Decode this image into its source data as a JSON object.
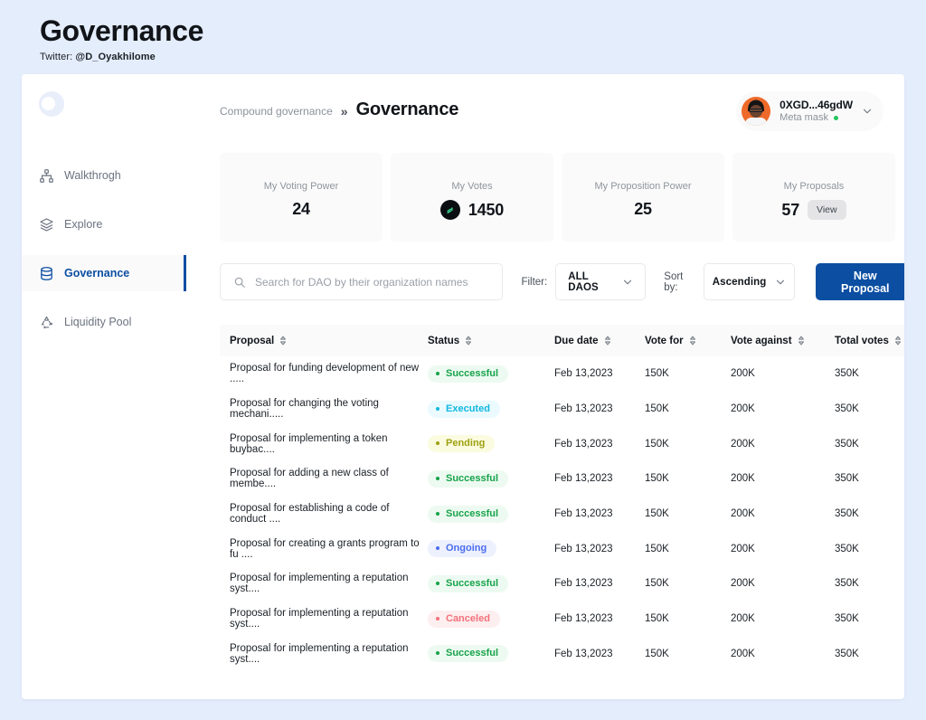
{
  "page": {
    "title": "Governance",
    "twitter_prefix": "Twitter: ",
    "twitter_handle": "@D_Oyakhilome",
    "background": "#e4edfc"
  },
  "sidebar": {
    "logo_name": "app-logo",
    "items": [
      {
        "label": "Walkthrogh",
        "icon": "sitemap-icon",
        "active": false
      },
      {
        "label": "Explore",
        "icon": "layers-icon",
        "active": false
      },
      {
        "label": "Governance",
        "icon": "database-icon",
        "active": true
      },
      {
        "label": "Liquidity Pool",
        "icon": "recycle-icon",
        "active": false
      }
    ],
    "active_color": "#0b4ea2"
  },
  "breadcrumb": {
    "parent": "Compound governance",
    "separator": "»",
    "current": "Governance"
  },
  "profile": {
    "address": "0XGD...46gdW",
    "wallet": "Meta mask",
    "status_color": "#22c55e",
    "chevron": "chevron-down-icon"
  },
  "stats": [
    {
      "label": "My Voting Power",
      "value": "24",
      "icon": null,
      "action": null
    },
    {
      "label": "My Votes",
      "value": "1450",
      "icon": "compound-coin-icon",
      "action": null
    },
    {
      "label": "My Proposition Power",
      "value": "25",
      "icon": null,
      "action": null
    },
    {
      "label": "My Proposals",
      "value": "57",
      "icon": null,
      "action": "View"
    }
  ],
  "toolbar": {
    "search_placeholder": "Search for DAO by their organization names",
    "search_value": "",
    "filter_label": "Filter:",
    "filter_value": "ALL DAOS",
    "sort_label": "Sort by:",
    "sort_value": "Ascending",
    "new_proposal_label": "New Proposal",
    "new_proposal_color": "#0b4ea2"
  },
  "table": {
    "columns": [
      {
        "key": "proposal",
        "label": "Proposal"
      },
      {
        "key": "status",
        "label": "Status"
      },
      {
        "key": "due",
        "label": "Due date"
      },
      {
        "key": "for",
        "label": "Vote for"
      },
      {
        "key": "against",
        "label": "Vote against"
      },
      {
        "key": "total",
        "label": "Total votes"
      }
    ],
    "status_styles": {
      "Successful": {
        "fg": "#17a34a",
        "bg": "#edfaf1"
      },
      "Executed": {
        "fg": "#12b8e0",
        "bg": "#eafaff"
      },
      "Pending": {
        "fg": "#9ea10f",
        "bg": "#fbfbe0"
      },
      "Ongoing": {
        "fg": "#4a6df0",
        "bg": "#edf0fd"
      },
      "Canceled": {
        "fg": "#f4717b",
        "bg": "#fdeeef"
      }
    },
    "rows": [
      {
        "proposal": "Proposal for funding development  of new .....",
        "status": "Successful",
        "due": "Feb 13,2023",
        "for": "150K",
        "against": "200K",
        "total": "350K"
      },
      {
        "proposal": "Proposal for changing the voting mechani.....",
        "status": "Executed",
        "due": "Feb 13,2023",
        "for": "150K",
        "against": "200K",
        "total": "350K"
      },
      {
        "proposal": "Proposal for implementing a token buybac....",
        "status": "Pending",
        "due": "Feb 13,2023",
        "for": "150K",
        "against": "200K",
        "total": "350K"
      },
      {
        "proposal": "Proposal for adding a new class of membe....",
        "status": "Successful",
        "due": "Feb 13,2023",
        "for": "150K",
        "against": "200K",
        "total": "350K"
      },
      {
        "proposal": "Proposal for establishing a code of conduct ....",
        "status": "Successful",
        "due": "Feb 13,2023",
        "for": "150K",
        "against": "200K",
        "total": "350K"
      },
      {
        "proposal": "Proposal for creating a grants program to fu ....",
        "status": "Ongoing",
        "due": "Feb 13,2023",
        "for": "150K",
        "against": "200K",
        "total": "350K"
      },
      {
        "proposal": "Proposal for implementing a reputation  syst....",
        "status": "Successful",
        "due": "Feb 13,2023",
        "for": "150K",
        "against": "200K",
        "total": "350K"
      },
      {
        "proposal": "Proposal for implementing a reputation  syst....",
        "status": "Canceled",
        "due": "Feb 13,2023",
        "for": "150K",
        "against": "200K",
        "total": "350K"
      },
      {
        "proposal": "Proposal for implementing a reputation  syst....",
        "status": "Successful",
        "due": "Feb 13,2023",
        "for": "150K",
        "against": "200K",
        "total": "350K"
      }
    ]
  }
}
